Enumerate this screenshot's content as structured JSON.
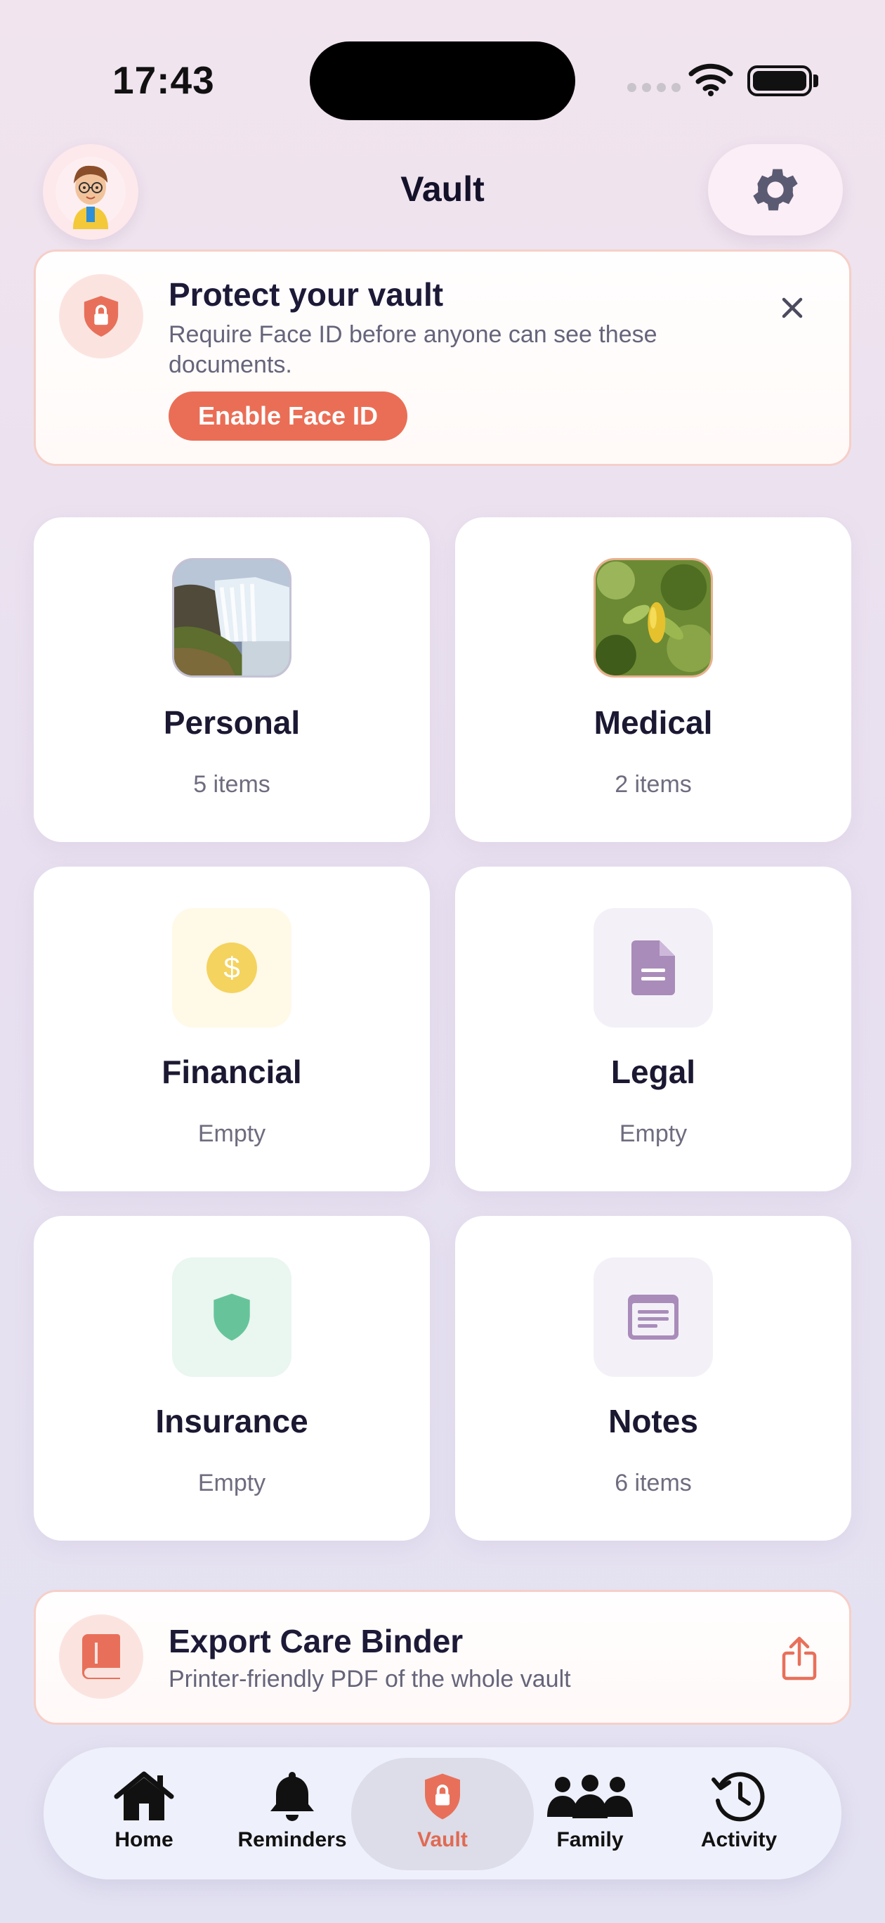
{
  "status_bar": {
    "time": "17:43"
  },
  "header": {
    "title": "Vault"
  },
  "banner": {
    "title": "Protect your vault",
    "subtitle": "Require Face ID before anyone can see these documents.",
    "button_label": "Enable Face ID"
  },
  "categories": [
    {
      "name": "Personal",
      "count": "5 items",
      "icon": "waterfall-photo"
    },
    {
      "name": "Medical",
      "count": "2 items",
      "icon": "leaves-photo"
    },
    {
      "name": "Financial",
      "count": "Empty",
      "icon": "dollar-icon"
    },
    {
      "name": "Legal",
      "count": "Empty",
      "icon": "document-icon"
    },
    {
      "name": "Insurance",
      "count": "Empty",
      "icon": "shield-icon"
    },
    {
      "name": "Notes",
      "count": "6 items",
      "icon": "note-icon"
    }
  ],
  "export": {
    "title": "Export Care Binder",
    "subtitle": "Printer-friendly PDF of the whole vault"
  },
  "tabs": [
    {
      "label": "Home",
      "icon": "house-icon",
      "active": false
    },
    {
      "label": "Reminders",
      "icon": "bell-icon",
      "active": false
    },
    {
      "label": "Vault",
      "icon": "lock-shield-icon",
      "active": true
    },
    {
      "label": "Family",
      "icon": "people-icon",
      "active": false
    },
    {
      "label": "Activity",
      "icon": "history-icon",
      "active": false
    }
  ],
  "colors": {
    "accent": "#ea6e55",
    "background": "#ebe3f0",
    "title_text": "#1b1832"
  }
}
